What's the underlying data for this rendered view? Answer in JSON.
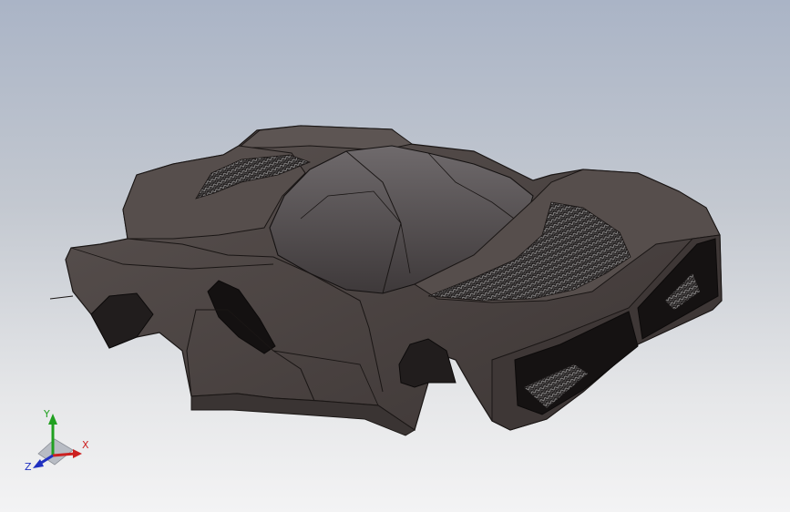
{
  "viewport": {
    "background_top_color": "#aab4c6",
    "background_bottom_color": "#f3f3f4",
    "model_color": "#4a4240",
    "carbon_pattern": "carbon-fiber-weave"
  },
  "triad": {
    "x_label": "X",
    "y_label": "Y",
    "z_label": "Z",
    "x_color": "#cc2020",
    "y_color": "#20a020",
    "z_color": "#2030c0"
  }
}
